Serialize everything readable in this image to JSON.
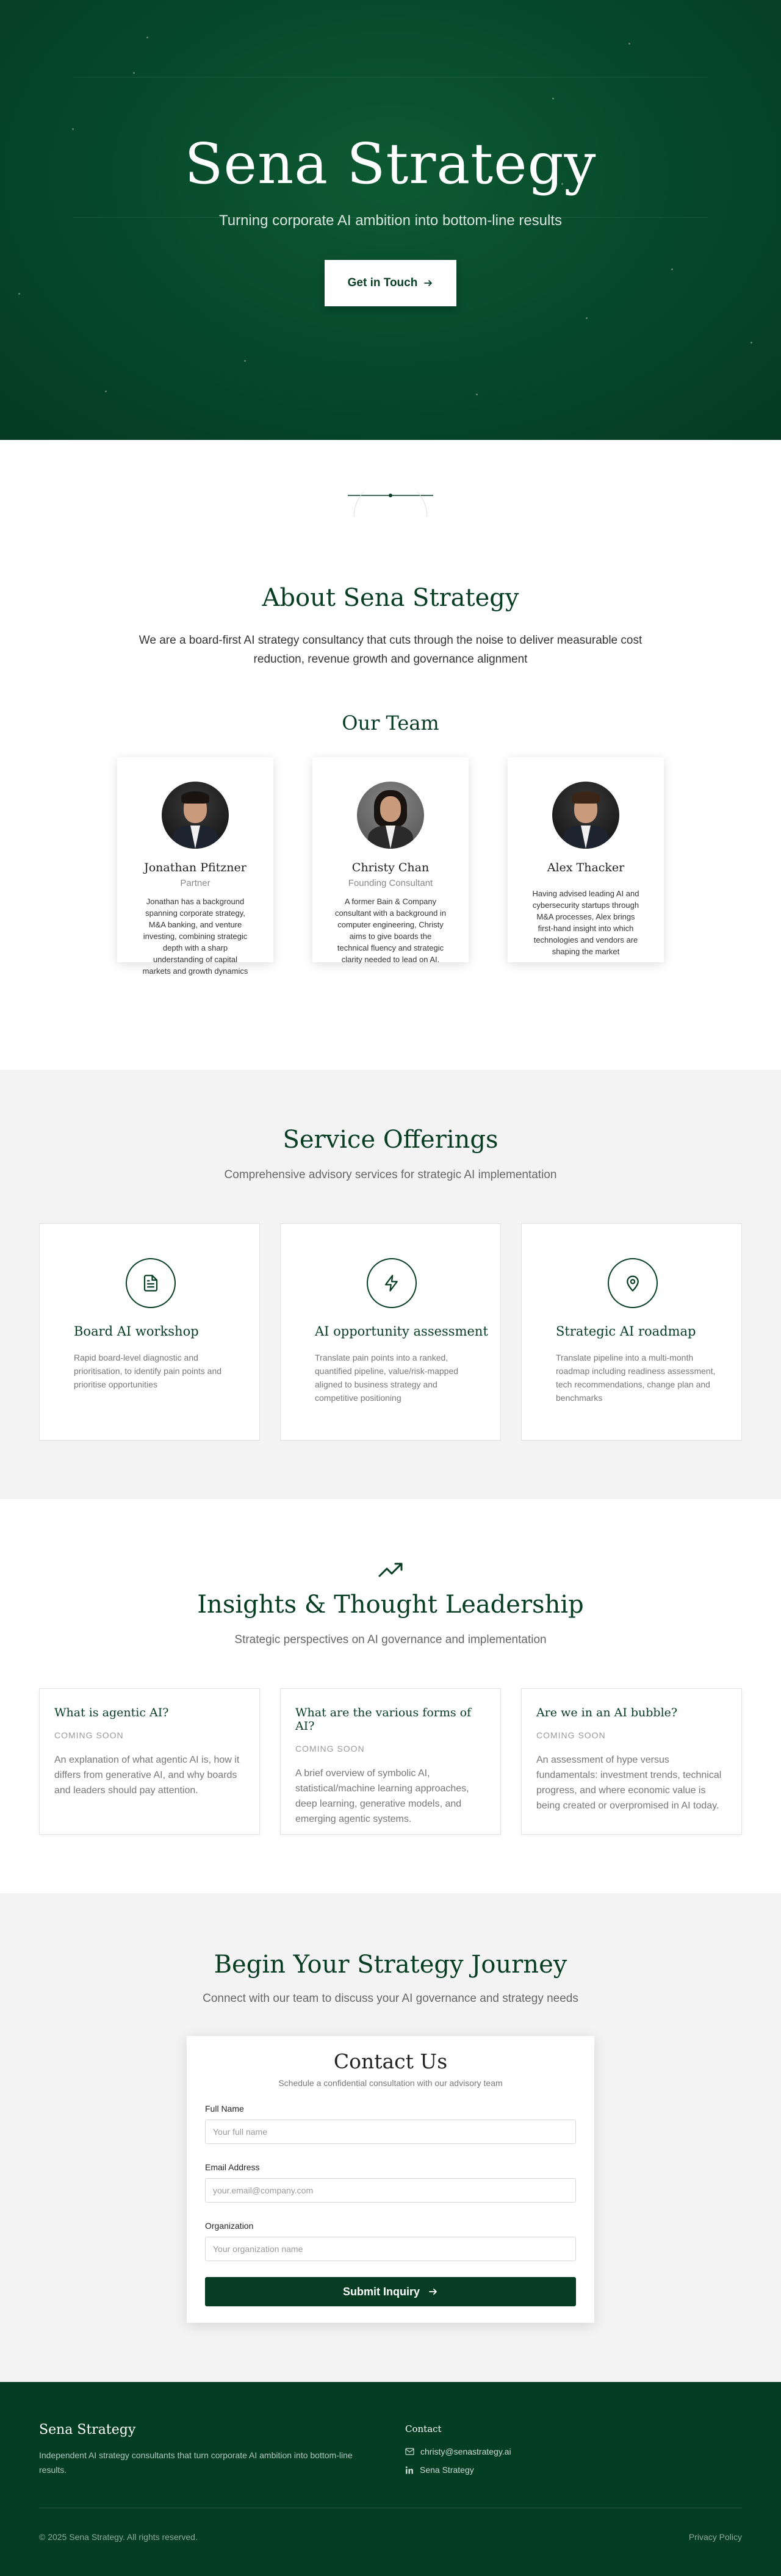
{
  "hero": {
    "title": "Sena Strategy",
    "tagline": "Turning corporate AI ambition into bottom-line results",
    "cta_label": "Get in Touch",
    "cta_icon": "arrow-right-icon"
  },
  "about": {
    "title": "About Sena Strategy",
    "description": "We are a board-first AI strategy consultancy that cuts through the noise to deliver measurable cost reduction, revenue growth and governance alignment",
    "team_title": "Our Team",
    "team": [
      {
        "name": "Jonathan Pfitzner",
        "role": "Partner",
        "bio": "Jonathan has a background spanning corporate strategy, M&A banking, and venture investing, combining strategic depth with a sharp understanding of capital markets and growth dynamics"
      },
      {
        "name": "Christy Chan",
        "role": "Founding Consultant",
        "bio": "A former Bain & Company consultant with a background in computer engineering, Christy aims to give boards the technical fluency and strategic clarity needed to lead on AI."
      },
      {
        "name": "Alex Thacker",
        "role": "",
        "bio": "Having advised leading AI and cybersecurity startups through M&A processes, Alex brings first-hand insight into which technologies and vendors are shaping the market"
      }
    ]
  },
  "services": {
    "title": "Service Offerings",
    "subtitle": "Comprehensive advisory services for strategic AI implementation",
    "items": [
      {
        "name": "Board AI workshop",
        "icon": "document-icon",
        "description": "Rapid board-level diagnostic and prioritisation, to identify pain points and prioritise opportunities"
      },
      {
        "name": "AI opportunity assessment",
        "icon": "lightning-icon",
        "description": "Translate pain points into a ranked, quantified pipeline, value/risk-mapped aligned to business strategy and competitive positioning"
      },
      {
        "name": "Strategic AI roadmap",
        "icon": "map-pin-icon",
        "description": "Translate pipeline into a multi-month roadmap including readiness assessment, tech recommendations, change plan and benchmarks"
      }
    ]
  },
  "insights": {
    "title": "Insights & Thought Leadership",
    "subtitle": "Strategic perspectives on AI governance and implementation",
    "icon": "trending-up-icon",
    "items": [
      {
        "title": "What is agentic AI?",
        "status": "COMING SOON",
        "description": "An explanation of what agentic AI is, how it differs from generative AI, and why boards and leaders should pay attention."
      },
      {
        "title": "What are the various forms of AI?",
        "status": "COMING SOON",
        "description": "A brief overview of symbolic AI, statistical/machine learning approaches, deep learning, generative models, and emerging agentic systems."
      },
      {
        "title": "Are we in an AI bubble?",
        "status": "COMING SOON",
        "description": "An assessment of hype versus fundamentals: investment trends, technical progress, and where economic value is being created or overpromised in AI today."
      }
    ]
  },
  "contact": {
    "title": "Begin Your Strategy Journey",
    "subtitle": "Connect with our team to discuss your AI governance and strategy needs",
    "form_title": "Contact Us",
    "form_subtitle": "Schedule a confidential consultation with our advisory team",
    "fields": {
      "name_label": "Full Name",
      "name_placeholder": "Your full name",
      "email_label": "Email Address",
      "email_placeholder": "your.email@company.com",
      "org_label": "Organization",
      "org_placeholder": "Your organization name"
    },
    "submit_label": "Submit Inquiry"
  },
  "footer": {
    "brand": "Sena Strategy",
    "brand_desc": "Independent AI strategy consultants that turn corporate AI ambition into bottom-line results.",
    "contact_heading": "Contact",
    "email": "christy@senastrategy.ai",
    "linkedin": "Sena Strategy",
    "copyright": "© 2025 Sena Strategy. All rights reserved.",
    "privacy": "Privacy Policy"
  },
  "colors": {
    "brand_green": "#063d23",
    "hero_green": "#06472a",
    "section_gray": "#f3f3f3"
  }
}
